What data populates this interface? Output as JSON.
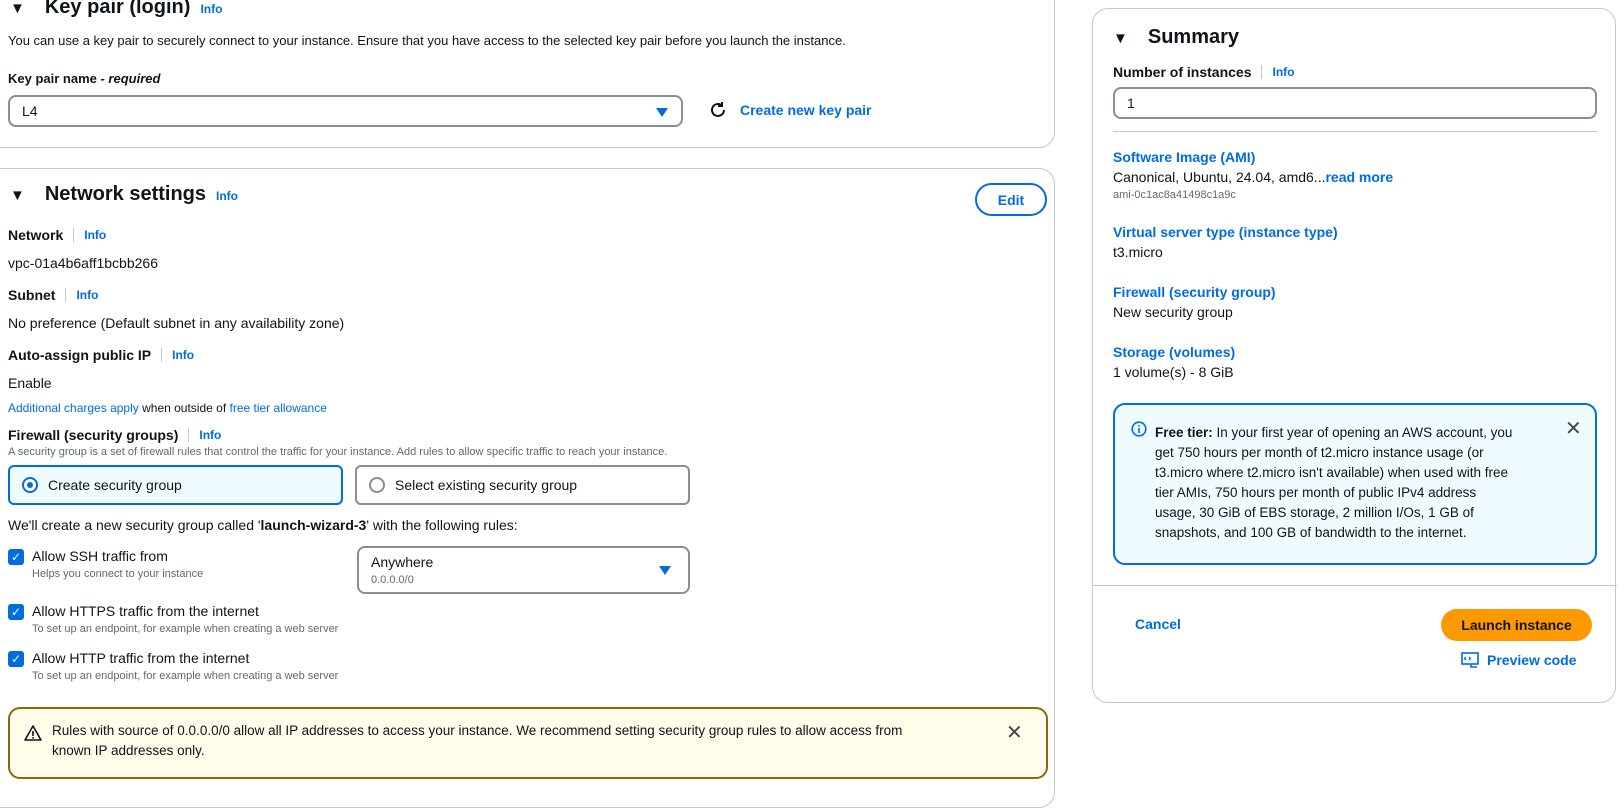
{
  "keypair": {
    "title": "Key pair (login)",
    "info": "Info",
    "description": "You can use a key pair to securely connect to your instance. Ensure that you have access to the selected key pair before you launch the instance.",
    "field_label": "Key pair name",
    "field_required": " - required",
    "selected": "L4",
    "create_link": "Create new key pair"
  },
  "network": {
    "title": "Network settings",
    "info": "Info",
    "edit_label": "Edit",
    "network_label": "Network",
    "network_value": "vpc-01a4b6aff1bcbb266",
    "subnet_label": "Subnet",
    "subnet_value": "No preference (Default subnet in any availability zone)",
    "public_ip_label": "Auto-assign public IP",
    "public_ip_value": "Enable",
    "charges_link": "Additional charges apply",
    "charges_mid": " when outside of ",
    "charges_link2": "free tier allowance",
    "firewall_label": "Firewall (security groups)",
    "firewall_desc": "A security group is a set of firewall rules that control the traffic for your instance. Add rules to allow specific traffic to reach your instance.",
    "radio_create": "Create security group",
    "radio_existing": "Select existing security group",
    "create_msg_pre": "We'll create a new security group called '",
    "create_msg_name": "launch-wizard-3",
    "create_msg_post": "' with the following rules:",
    "ssh_label": "Allow SSH traffic from",
    "ssh_hint": "Helps you connect to your instance",
    "ssh_source": "Anywhere",
    "ssh_source_sub": "0.0.0.0/0",
    "https_label": "Allow HTTPS traffic from the internet",
    "https_hint": "To set up an endpoint, for example when creating a web server",
    "http_label": "Allow HTTP traffic from the internet",
    "http_hint": "To set up an endpoint, for example when creating a web server",
    "warning_line1": "Rules with source of 0.0.0.0/0 allow all IP addresses to access your instance. We recommend setting security group rules to allow access from",
    "warning_line2": "known IP addresses only."
  },
  "summary": {
    "title": "Summary",
    "instances_label": "Number of instances",
    "info": "Info",
    "instances_value": "1",
    "ami_label": "Software Image (AMI)",
    "ami_value": "Canonical, Ubuntu, 24.04, amd6...",
    "ami_readmore": "read more",
    "ami_id": "ami-0c1ac8a41498c1a9c",
    "type_label": "Virtual server type (instance type)",
    "type_value": "t3.micro",
    "firewall_label": "Firewall (security group)",
    "firewall_value": "New security group",
    "storage_label": "Storage (volumes)",
    "storage_value": "1 volume(s) - 8 GiB",
    "freetier_title": "Free tier:",
    "freetier_lines": [
      " In your first year of opening an AWS account, you",
      "get 750 hours per month of t2.micro instance usage (or",
      "t3.micro where t2.micro isn't available) when used with free",
      "tier AMIs, 750 hours per month of public IPv4 address",
      "usage, 30 GiB of EBS storage, 2 million I/Os, 1 GB of",
      "snapshots, and 100 GB of bandwidth to the internet."
    ],
    "cancel_label": "Cancel",
    "launch_label": "Launch instance",
    "preview_label": "Preview code"
  },
  "colors": {
    "accent": "#006ce0",
    "launch": "#ff9900",
    "warning_border": "#8d6605"
  }
}
